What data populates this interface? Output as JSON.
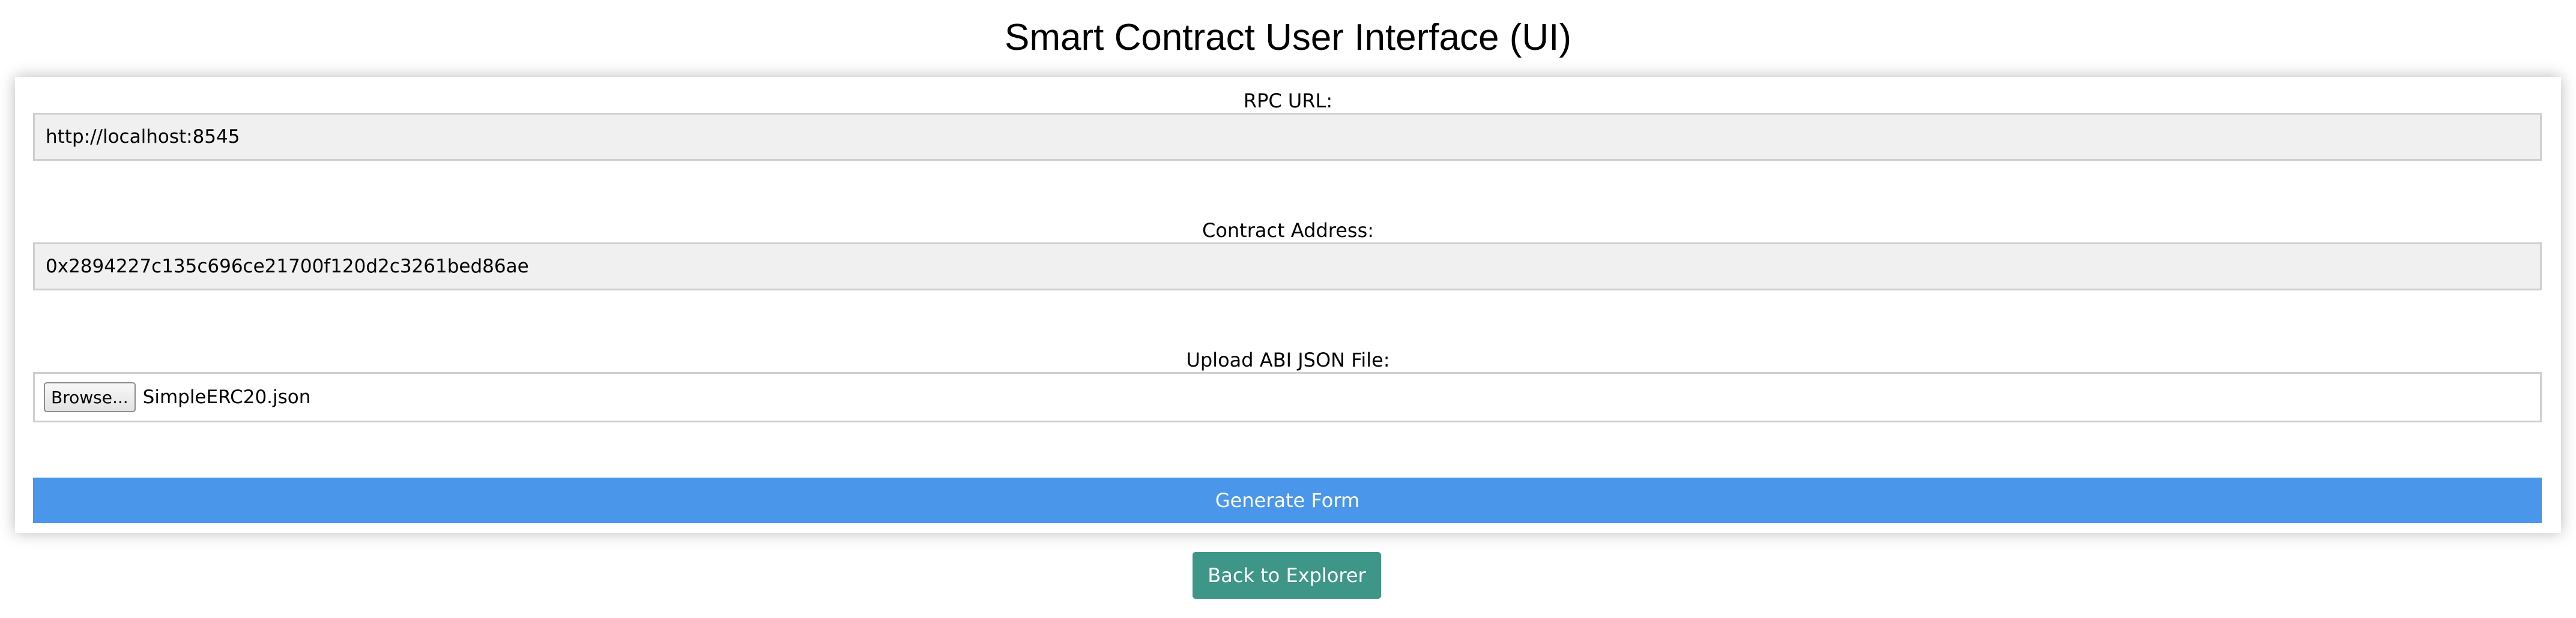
{
  "page": {
    "title": "Smart Contract User Interface (UI)"
  },
  "form": {
    "rpc_url": {
      "label": "RPC URL:",
      "value": "http://localhost:8545"
    },
    "contract_address": {
      "label": "Contract Address:",
      "value": "0x2894227c135c696ce21700f120d2c3261bed86ae"
    },
    "abi_upload": {
      "label": "Upload ABI JSON File:",
      "browse_label": "Browse...",
      "file_name": "SimpleERC20.json"
    },
    "generate_label": "Generate Form"
  },
  "footer": {
    "back_label": "Back to Explorer"
  },
  "colors": {
    "generate_button": "#4a96ea",
    "back_button": "#3d9688",
    "input_background": "#f0f0f0"
  }
}
